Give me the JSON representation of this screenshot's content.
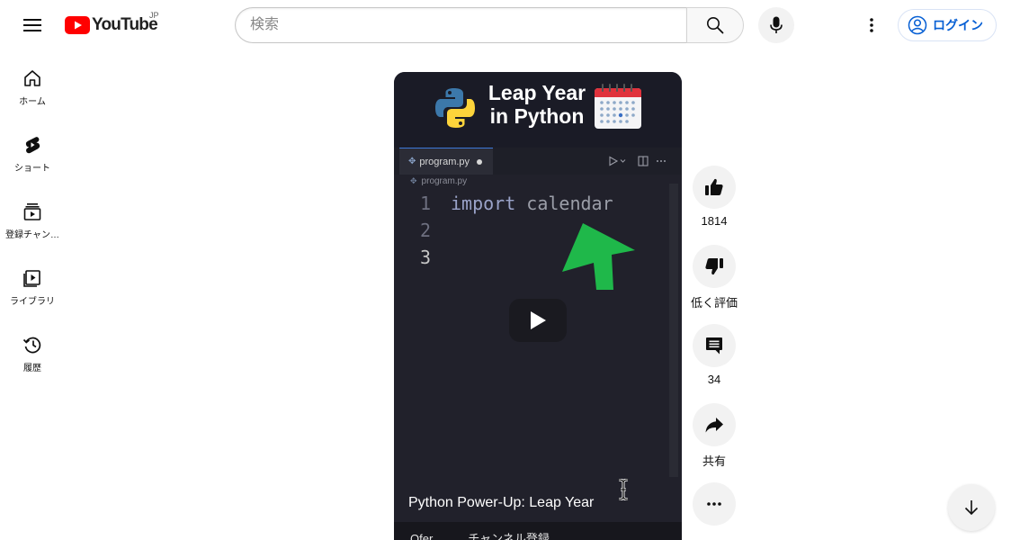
{
  "header": {
    "logo_text": "YouTube",
    "region": "JP",
    "search_placeholder": "検索",
    "login_label": "ログイン"
  },
  "sidebar": {
    "items": [
      {
        "label": "ホーム",
        "icon": "home-icon"
      },
      {
        "label": "ショート",
        "icon": "shorts-icon"
      },
      {
        "label": "登録チャン…",
        "icon": "subscriptions-icon"
      },
      {
        "label": "ライブラリ",
        "icon": "library-icon"
      },
      {
        "label": "履歴",
        "icon": "history-icon"
      }
    ]
  },
  "video": {
    "thumb_title_line1": "Leap Year",
    "thumb_title_line2": "in Python",
    "editor_tab": "program.py",
    "breadcrumb": "program.py",
    "code_lines": [
      {
        "num": "1",
        "keyword": "import",
        "rest": " calendar"
      },
      {
        "num": "2",
        "keyword": "",
        "rest": ""
      },
      {
        "num": "3",
        "keyword": "",
        "rest": ""
      }
    ],
    "caption": "Python Power-Up: Leap Year",
    "channel_text": "Ofer....  ..... チャンネル登録"
  },
  "actions": {
    "like_count": "1814",
    "dislike_label": "低く評価",
    "comment_count": "34",
    "share_label": "共有"
  },
  "colors": {
    "brand_red": "#ff0000",
    "link_blue": "#065fd4",
    "player_bg": "#21212b",
    "arrow_green": "#1fb84a"
  }
}
